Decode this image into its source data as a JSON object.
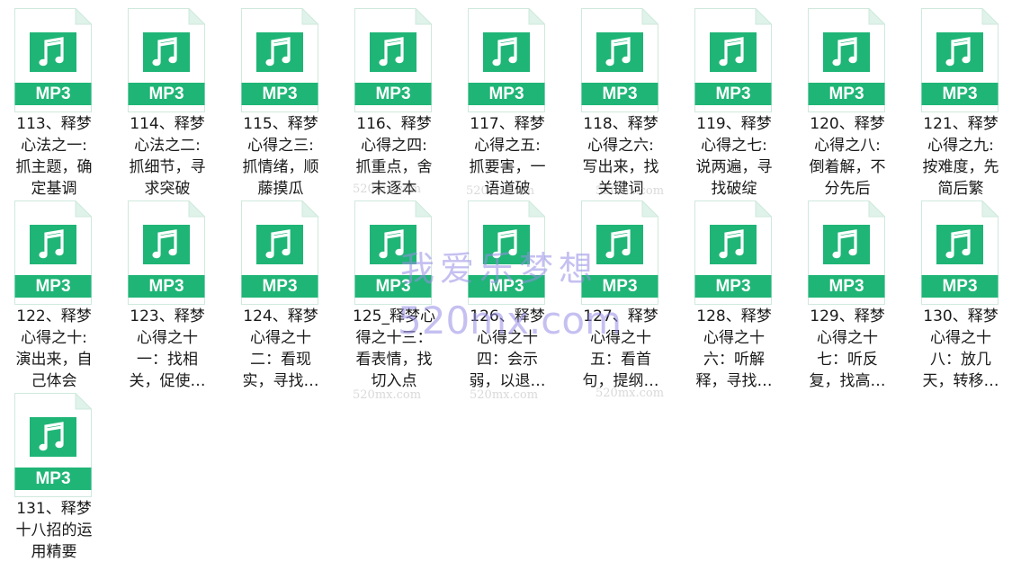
{
  "files": [
    {
      "icon": "mp3-file-icon",
      "type_label": "MP3",
      "name_lines": [
        "113、释梦",
        "心法之一:",
        "抓主题，确",
        "定基调"
      ]
    },
    {
      "icon": "mp3-file-icon",
      "type_label": "MP3",
      "name_lines": [
        "114、释梦",
        "心法之二:",
        "抓细节，寻",
        "求突破"
      ]
    },
    {
      "icon": "mp3-file-icon",
      "type_label": "MP3",
      "name_lines": [
        "115、释梦",
        "心得之三:",
        "抓情绪，顺",
        "藤摸瓜"
      ]
    },
    {
      "icon": "mp3-file-icon",
      "type_label": "MP3",
      "name_lines": [
        "116、释梦",
        "心得之四:",
        "抓重点，舍",
        "末逐本"
      ]
    },
    {
      "icon": "mp3-file-icon",
      "type_label": "MP3",
      "name_lines": [
        "117、释梦",
        "心得之五:",
        "抓要害，一",
        "语道破"
      ]
    },
    {
      "icon": "mp3-file-icon",
      "type_label": "MP3",
      "name_lines": [
        "118、释梦",
        "心得之六:",
        "写出来，找",
        "关键词"
      ]
    },
    {
      "icon": "mp3-file-icon",
      "type_label": "MP3",
      "name_lines": [
        "119、释梦",
        "心得之七:",
        "说两遍，寻",
        "找破绽"
      ]
    },
    {
      "icon": "mp3-file-icon",
      "type_label": "MP3",
      "name_lines": [
        "120、释梦",
        "心得之八:",
        "倒着解，不",
        "分先后"
      ]
    },
    {
      "icon": "mp3-file-icon",
      "type_label": "MP3",
      "name_lines": [
        "121、释梦",
        "心得之九:",
        "按难度，先",
        "简后繁"
      ]
    },
    {
      "icon": "mp3-file-icon",
      "type_label": "MP3",
      "name_lines": [
        "122、释梦",
        "心得之十:",
        "演出来，自",
        "己体会"
      ]
    },
    {
      "icon": "mp3-file-icon",
      "type_label": "MP3",
      "name_lines": [
        "123、释梦",
        "心得之十",
        "一：找相",
        "关，促使…"
      ]
    },
    {
      "icon": "mp3-file-icon",
      "type_label": "MP3",
      "name_lines": [
        "124、释梦",
        "心得之十",
        "二：看现",
        "实，寻找…"
      ]
    },
    {
      "icon": "mp3-file-icon",
      "type_label": "MP3",
      "name_lines": [
        "125_释梦心",
        "得之十三：",
        "看表情，找",
        "切入点"
      ]
    },
    {
      "icon": "mp3-file-icon",
      "type_label": "MP3",
      "name_lines": [
        "126、释梦",
        "心得之十",
        "四：会示",
        "弱，以退…"
      ]
    },
    {
      "icon": "mp3-file-icon",
      "type_label": "MP3",
      "name_lines": [
        "127、释梦",
        "心得之十",
        "五：看首",
        "句，提纲…"
      ]
    },
    {
      "icon": "mp3-file-icon",
      "type_label": "MP3",
      "name_lines": [
        "128、释梦",
        "心得之十",
        "六：听解",
        "释，寻找…"
      ]
    },
    {
      "icon": "mp3-file-icon",
      "type_label": "MP3",
      "name_lines": [
        "129、释梦",
        "心得之十",
        "七：听反",
        "复，找高…"
      ]
    },
    {
      "icon": "mp3-file-icon",
      "type_label": "MP3",
      "name_lines": [
        "130、释梦",
        "心得之十",
        "八：放几",
        "天，转移…"
      ]
    },
    {
      "icon": "mp3-file-icon",
      "type_label": "MP3",
      "name_lines": [
        "131、释梦",
        "十八招的运",
        "用精要"
      ]
    }
  ],
  "watermark": {
    "main": "我爱乐梦想",
    "url": "520mx.com",
    "small": "520mx.com"
  },
  "colors": {
    "icon_green": "#1fb576",
    "icon_sheet": "#ffffff",
    "icon_border": "#cfe9dd",
    "icon_fold": "#dff3ea",
    "text": "#1a1a1a"
  }
}
